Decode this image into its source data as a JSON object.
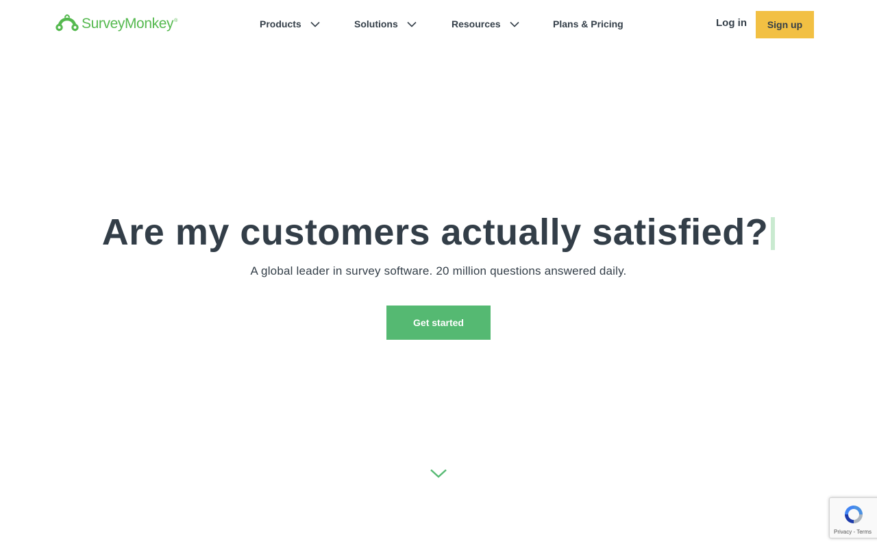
{
  "brand": {
    "name": "SurveyMonkey",
    "reg_mark": "®",
    "color": "#55b94f"
  },
  "nav": {
    "items": [
      {
        "label": "Products",
        "has_dropdown": true
      },
      {
        "label": "Solutions",
        "has_dropdown": true
      },
      {
        "label": "Resources",
        "has_dropdown": true
      },
      {
        "label": "Plans & Pricing",
        "has_dropdown": false
      }
    ],
    "login_label": "Log in",
    "signup_label": "Sign up",
    "signup_color": "#f2c043"
  },
  "hero": {
    "title": "Are my customers actually satisfied?",
    "subtitle": "A global leader in survey software. 20 million questions answered daily.",
    "cta_label": "Get started",
    "cta_color": "#55b972",
    "scroll_icon": "chevron-down-icon"
  },
  "recaptcha": {
    "links": [
      "Privacy",
      "Terms"
    ],
    "separator": " - "
  }
}
